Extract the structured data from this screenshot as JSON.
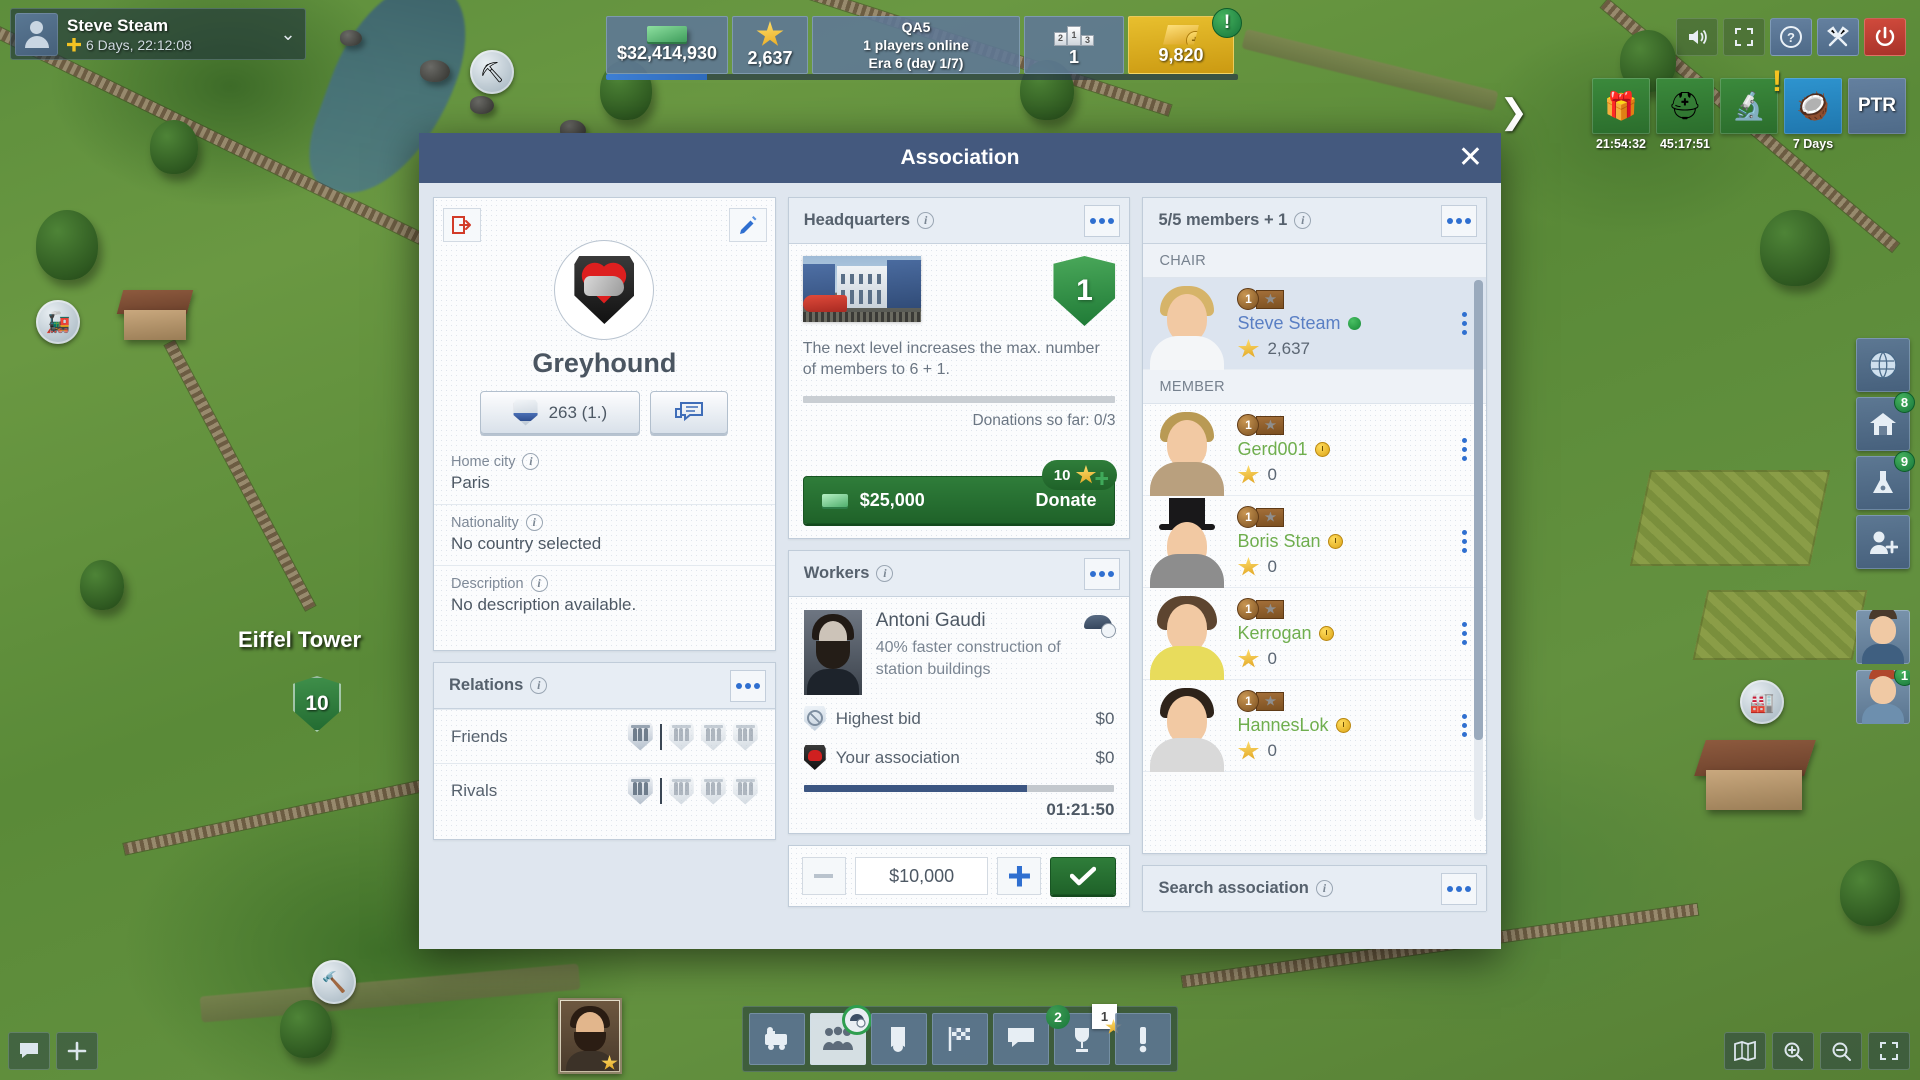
{
  "player": {
    "name": "Steve Steam",
    "session_time": "6 Days, 22:12:08",
    "plus_icon": "plus-badge-icon",
    "chevron": "⌄"
  },
  "resources": {
    "money": "$32,414,930",
    "prestige": "2,637",
    "server_name": "QA5",
    "players_online": "1 players online",
    "era": "Era 6 (day 1/7)",
    "rank": "1",
    "gold": "9,820",
    "gold_alert": "!"
  },
  "system_buttons": [
    {
      "name": "sound-icon",
      "glyph": "🔊"
    },
    {
      "name": "fullscreen-icon",
      "glyph": "⛶"
    },
    {
      "name": "support-icon",
      "glyph": "?"
    },
    {
      "name": "settings-icon",
      "glyph": "⚒"
    },
    {
      "name": "power-icon",
      "glyph": "⏻"
    }
  ],
  "events": [
    {
      "name": "gift-box-event",
      "label": "21:54:32",
      "glyph": "🎁",
      "tile": "ev-green"
    },
    {
      "name": "hard-hat-event",
      "label": "45:17:51",
      "glyph": "⛑",
      "tile": "ev-green"
    },
    {
      "name": "research-event",
      "label": "",
      "glyph": "🔬",
      "tile": "ev-green",
      "alert": "!"
    },
    {
      "name": "coconut-event",
      "label": "7 Days",
      "glyph": "🥥",
      "tile": "ev-blue"
    },
    {
      "name": "ptr-event",
      "label": "",
      "text": "PTR",
      "glyph": "📢",
      "tile": "ev-navy"
    }
  ],
  "collapse_arrow": "❯",
  "right_tools": [
    {
      "name": "globe-tool",
      "glyph": "🌐",
      "badge": ""
    },
    {
      "name": "house-tool",
      "glyph": "🏠",
      "badge": "8"
    },
    {
      "name": "research-tool",
      "glyph": "🔭",
      "badge": "9"
    },
    {
      "name": "add-contact-tool",
      "glyph": "👤",
      "badge": ""
    }
  ],
  "right_avatars": [
    {
      "name": "advisor-avatar-1",
      "badge": ""
    },
    {
      "name": "advisor-avatar-2",
      "badge": "1"
    }
  ],
  "map": {
    "landmark_label": "Eiffel Tower",
    "landmark_level": "10"
  },
  "taskbar": [
    {
      "name": "trains-tab",
      "glyph": "🚂",
      "active": false
    },
    {
      "name": "workers-tab",
      "glyph": "👥",
      "active": true
    },
    {
      "name": "contracts-tab",
      "glyph": "📜",
      "active": false
    },
    {
      "name": "races-tab",
      "glyph": "🏁",
      "active": false
    },
    {
      "name": "chat-tab",
      "glyph": "💬",
      "active": false
    },
    {
      "name": "achievements-tab",
      "glyph": "🏆",
      "active": false,
      "badge_green": "2",
      "badge_white": "1"
    },
    {
      "name": "alerts-tab",
      "glyph": "❗",
      "active": false
    }
  ],
  "bottom_left": [
    {
      "name": "chat-bubble-icon",
      "glyph": "💬"
    },
    {
      "name": "add-icon",
      "glyph": "➕"
    }
  ],
  "bottom_right": [
    {
      "name": "minimap-icon",
      "glyph": "🗺"
    },
    {
      "name": "zoom-in-icon",
      "glyph": "🔍"
    },
    {
      "name": "zoom-out-icon",
      "glyph": "🔎"
    },
    {
      "name": "fullscreen-map-icon",
      "glyph": "⛶"
    }
  ],
  "modal": {
    "title": "Association",
    "close": "✕"
  },
  "association": {
    "leave_icon": "leave-association-icon",
    "edit_icon": "edit-pencil-icon",
    "crest": "greyhound-heart-crest",
    "name": "Greyhound",
    "score_button": "263 (1.)",
    "chat_button_icon": "chat-icon",
    "fields": [
      {
        "label": "Home city",
        "value": "Paris"
      },
      {
        "label": "Nationality",
        "value": "No country selected"
      },
      {
        "label": "Description",
        "value": "No description available."
      }
    ]
  },
  "relations": {
    "title": "Relations",
    "rows": [
      {
        "label": "Friends",
        "owned": 1,
        "empty": 3
      },
      {
        "label": "Rivals",
        "owned": 1,
        "empty": 3
      }
    ]
  },
  "headquarters": {
    "title": "Headquarters",
    "level": "1",
    "description": "The next level increases the max. number of members to 6 + 1.",
    "donations_text": "Donations so far: 0/3",
    "progress_percent": 0,
    "donate_amount": "$25,000",
    "donate_label": "Donate",
    "donate_badge_count": "10"
  },
  "workers": {
    "title": "Workers",
    "worker_name": "Antoni Gaudi",
    "worker_bonus": "40% faster construction of station buildings",
    "worker_icon": "worker-cap-clock-icon",
    "highest_bid_label": "Highest bid",
    "highest_bid_value": "$0",
    "your_association_label": "Your association",
    "your_association_value": "$0",
    "timer": "01:21:50",
    "progress_percent": 72,
    "bid_value": "$10,000",
    "decrease_icon": "minus-icon",
    "increase_icon": "plus-icon",
    "confirm_icon": "check-icon"
  },
  "members": {
    "title": "5/5 members + 1",
    "sections": [
      {
        "label": "CHAIR",
        "rows": [
          {
            "name": "Steve Steam",
            "rank": "1",
            "score": "2,637",
            "status": "online",
            "highlight": true,
            "hair": "#d6b469",
            "body": "#f4f6f8",
            "hat": false
          }
        ]
      },
      {
        "label": "MEMBER",
        "rows": [
          {
            "name": "Gerd001",
            "rank": "1",
            "score": "0",
            "status": "away",
            "highlight": false,
            "hair": "#b99a54",
            "body": "#b9a07e",
            "hat": false
          },
          {
            "name": "Boris Stan",
            "rank": "1",
            "score": "0",
            "status": "away",
            "highlight": false,
            "hair": "#6b5338",
            "body": "#8d8d8d",
            "hat": true
          },
          {
            "name": "Kerrogan",
            "rank": "1",
            "score": "0",
            "status": "away",
            "highlight": false,
            "hair": "#5d4530",
            "body": "#e8dc5c",
            "hat": false
          },
          {
            "name": "HannesLok",
            "rank": "1",
            "score": "0",
            "status": "away",
            "highlight": false,
            "hair": "#2e231a",
            "body": "#d9d9d9",
            "hat": false
          }
        ]
      }
    ]
  },
  "search_association": {
    "title": "Search association"
  }
}
